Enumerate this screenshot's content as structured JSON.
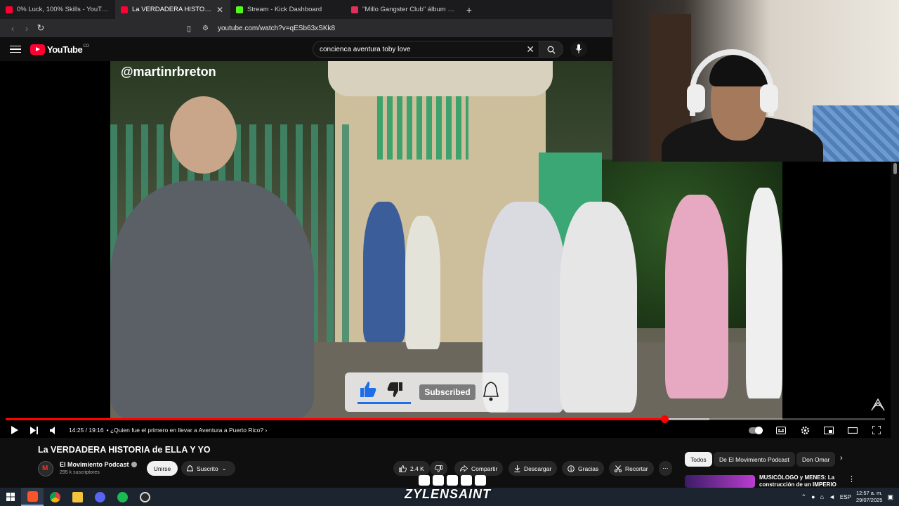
{
  "browser": {
    "tabs": [
      {
        "title": "0% Luck, 100% Skills - YouTube",
        "favicon": "youtube-icon",
        "active": false
      },
      {
        "title": "La VERDADERA HISTORIA de",
        "favicon": "youtube-icon",
        "active": true
      },
      {
        "title": "Stream - Kick Dashboard",
        "favicon": "kick-icon",
        "active": false
      },
      {
        "title": "\"Millo Gangster Club\" álbum de Bryan",
        "favicon": "music-icon",
        "active": false
      }
    ],
    "url": "youtube.com/watch?v=qESb63xSKk8"
  },
  "masthead": {
    "logo_text": "YouTube",
    "region": "CO",
    "search_query": "concienca aventura toby love"
  },
  "player": {
    "overlay_handle": "@martinrbreton",
    "subscribe_overlay_label": "Subscribed",
    "time_display": "14:25 / 19:16",
    "chapter": "• ¿Quien fue el primero en llevar a Aventura a Puerto Rico? ›",
    "progress_played": 0.749,
    "progress_buffered": 0.8,
    "colors": {
      "progress": "#ff0000"
    }
  },
  "video": {
    "title": "La VERDADERA HISTORIA de ELLA Y YO",
    "channel_name": "El Movimiento Podcast",
    "subscribers": "295 k suscriptores",
    "join_label": "Unirse",
    "subscribed_label": "Suscrito",
    "likes": "2.4 K",
    "share_label": "Compartir",
    "download_label": "Descargar",
    "thanks_label": "Gracias",
    "clip_label": "Recortar"
  },
  "sidebar": {
    "chips": [
      "Todos",
      "De El Movimiento Podcast",
      "Don Omar"
    ],
    "recommendation_title": "MUSICÓLOGO y MENES: La construcción de un IMPERIO"
  },
  "stream_overlay": {
    "streamer_name": "ZYLENSAINT",
    "social_icons": [
      "kick-icon",
      "instagram-icon",
      "youtube-icon",
      "x-icon",
      "tiktok-icon"
    ]
  },
  "taskbar": {
    "apps": [
      "brave-icon",
      "chrome-icon",
      "file-explorer-icon",
      "discord-icon",
      "spotify-icon",
      "obs-icon"
    ],
    "language": "ESP",
    "time": "12:57 a. m.",
    "date": "29/07/2025"
  }
}
